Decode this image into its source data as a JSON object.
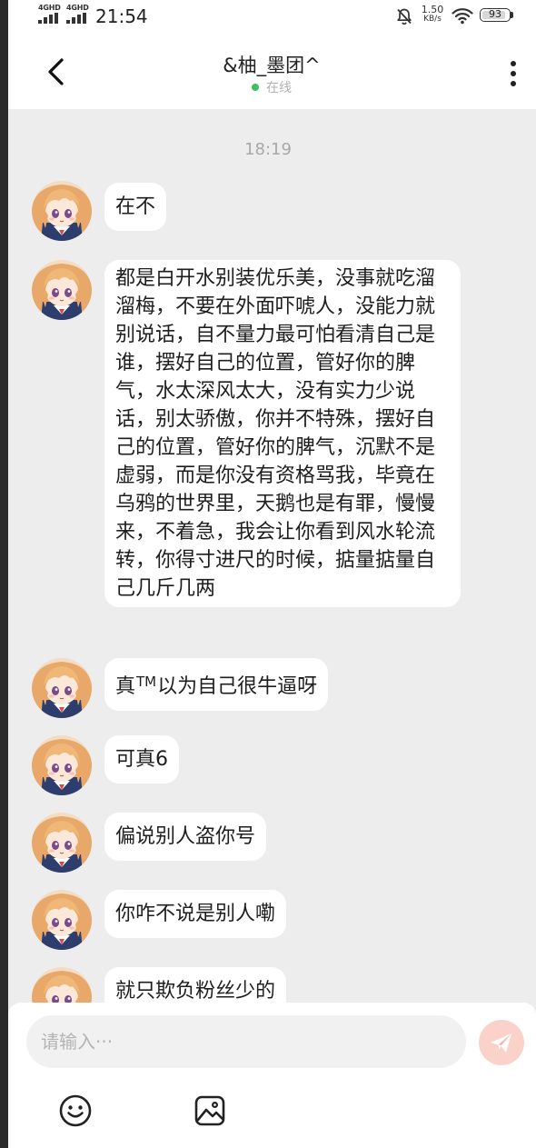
{
  "status_bar": {
    "signal_1_label": "4GHD",
    "signal_2_label": "4GHD",
    "time": "21:54",
    "speed_value": "1.50",
    "speed_unit": "KB/s",
    "battery_level": "93",
    "icons": [
      "mute-bell-icon",
      "wifi-icon",
      "battery-icon"
    ]
  },
  "header": {
    "contact_name": "&柚_墨团^",
    "status_text": "在线",
    "status_color": "#3cc063",
    "icons": [
      "chevron-left-icon",
      "more-vertical-icon"
    ]
  },
  "conversation": {
    "time_divider": "18:19",
    "messages": [
      {
        "sender": "contact",
        "text": "在不"
      },
      {
        "sender": "contact",
        "text": "都是白开水别装优乐美，没事就吃溜溜梅，不要在外面吓唬人，没能力就别说话，自不量力最可怕看清自己是谁，摆好自己的位置，管好你的脾气，水太深风太大，没有实力少说话，别太骄傲，你并不特殊，摆好自己的位置，管好你的脾气，沉默不是虚弱，而是你没有资格骂我，毕竟在乌鸦的世界里，天鹅也是有罪，慢慢来，不着急，我会让你看到风水轮流转，你得寸进尺的时候，掂量掂量自己几斤几两"
      },
      {
        "sender": "contact",
        "text_before": "真",
        "text_tm": "TM",
        "text_after": "以为自己很牛逼呀"
      },
      {
        "sender": "contact",
        "text": "可真6"
      },
      {
        "sender": "contact",
        "text": "偏说别人盗你号"
      },
      {
        "sender": "contact",
        "text": "你咋不说是别人嘞"
      },
      {
        "sender": "contact",
        "text": "就只欺负粉丝少的"
      }
    ]
  },
  "composer": {
    "placeholder": "请输入···",
    "value": "",
    "send_button_color": "#fbd2ca",
    "icons": [
      "send-icon",
      "emoji-icon",
      "image-icon"
    ]
  },
  "colors": {
    "background": "#ededed",
    "bubble": "#ffffff",
    "online_dot": "#3cc063"
  }
}
